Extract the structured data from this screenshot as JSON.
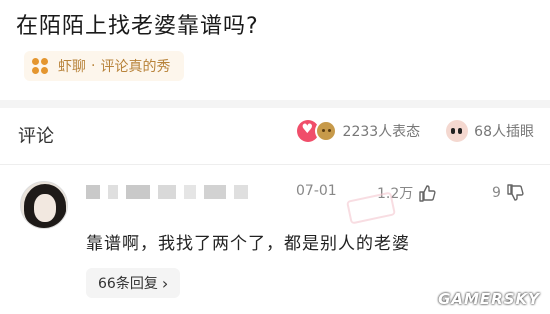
{
  "question": {
    "title": "在陌陌上找老婆靠谱吗?"
  },
  "source": {
    "app": "虾聊",
    "separator": "·",
    "channel": "评论真的秀"
  },
  "comments_section": {
    "heading": "评论",
    "reactions_label": "2233人表态",
    "illustrations_label": "68人插眼"
  },
  "comment": {
    "date": "07-01",
    "likes": "1.2万",
    "dislikes": "9",
    "text": "靠谱啊，我找了两个了，都是别人的老婆",
    "replies": "66条回复",
    "replies_arrow": "›"
  },
  "watermark": {
    "text": "GAMERSKY"
  },
  "colors": {
    "accent": "#b8833a",
    "tag_bg": "#fdf6ec",
    "heart": "#f04e6a"
  }
}
